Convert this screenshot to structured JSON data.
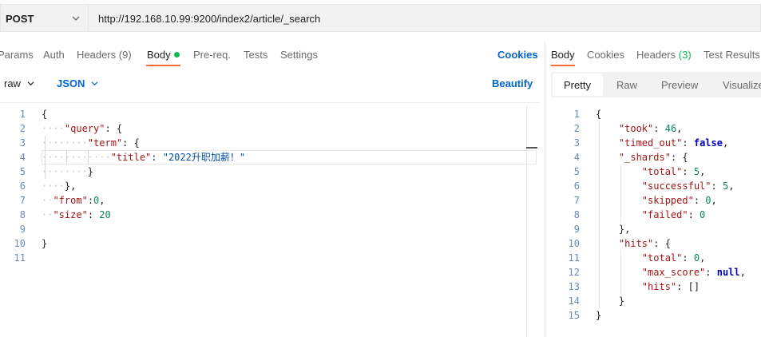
{
  "request": {
    "method": "POST",
    "url": "http://192.168.10.99:9200/index2/article/_search"
  },
  "request_tabs": {
    "params": "Params",
    "auth": "Auth",
    "headers": "Headers",
    "headers_count": "(9)",
    "body": "Body",
    "prereq": "Pre-req.",
    "tests": "Tests",
    "settings": "Settings",
    "cookies": "Cookies"
  },
  "body_options": {
    "mode": "raw",
    "language": "JSON",
    "beautify": "Beautify"
  },
  "editor": {
    "line_numbers": [
      "1",
      "2",
      "3",
      "4",
      "5",
      "6",
      "7",
      "8",
      "9",
      "10",
      "11"
    ]
  },
  "response_tabs": {
    "body": "Body",
    "cookies": "Cookies",
    "headers": "Headers",
    "headers_count": "(3)",
    "test_results": "Test Results"
  },
  "response_view": {
    "pretty": "Pretty",
    "raw": "Raw",
    "preview": "Preview",
    "visualize": "Visualize"
  },
  "response": {
    "line_numbers": [
      "1",
      "2",
      "3",
      "4",
      "5",
      "6",
      "7",
      "8",
      "9",
      "10",
      "11",
      "12",
      "13",
      "14",
      "15"
    ]
  },
  "colors": {
    "accent": "#ff6c37",
    "link": "#0265d2",
    "success": "#0cbb52"
  }
}
